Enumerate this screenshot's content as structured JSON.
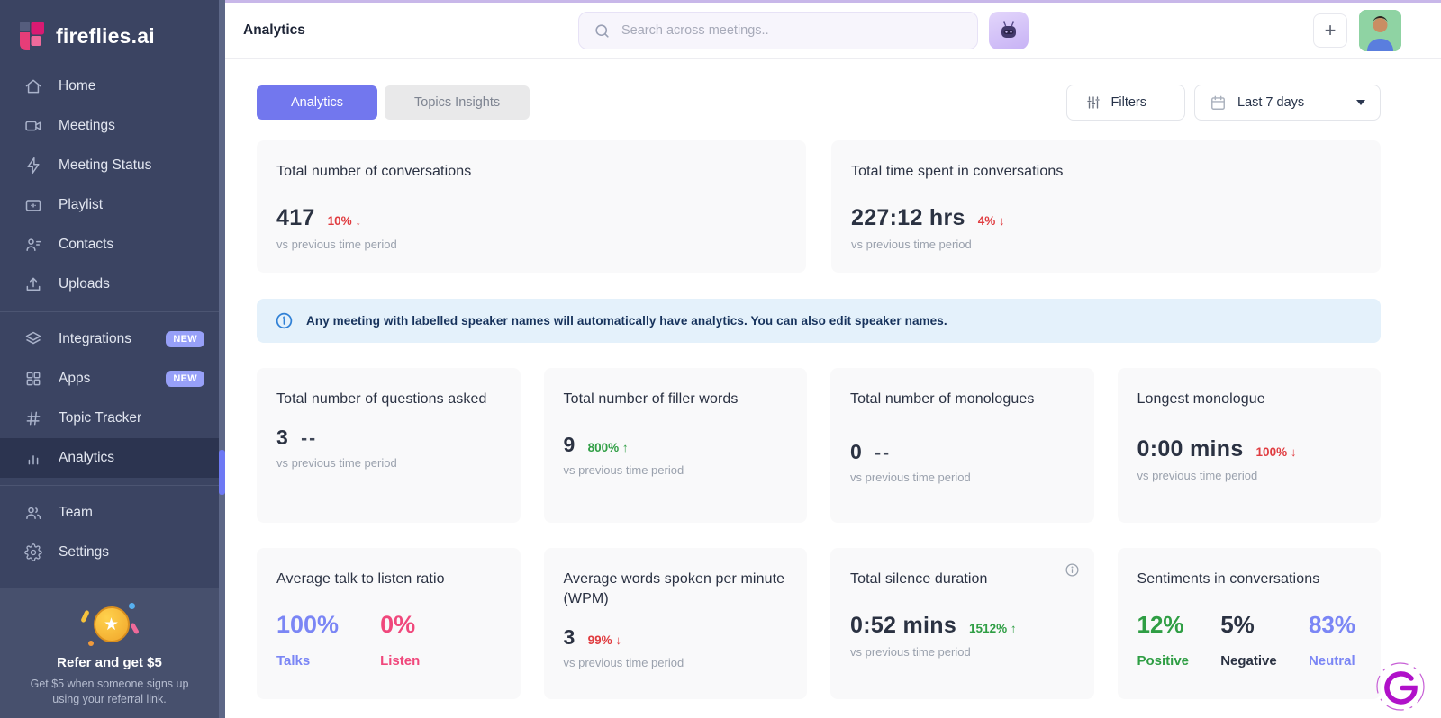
{
  "brand": {
    "name": "fireflies.ai"
  },
  "sidebar": {
    "items": [
      {
        "label": "Home"
      },
      {
        "label": "Meetings"
      },
      {
        "label": "Meeting Status"
      },
      {
        "label": "Playlist"
      },
      {
        "label": "Contacts"
      },
      {
        "label": "Uploads"
      },
      {
        "label": "Integrations",
        "badge": "NEW"
      },
      {
        "label": "Apps",
        "badge": "NEW"
      },
      {
        "label": "Topic Tracker"
      },
      {
        "label": "Analytics"
      },
      {
        "label": "Team"
      },
      {
        "label": "Settings"
      }
    ],
    "referral": {
      "title": "Refer and get $5",
      "subtitle": "Get $5 when someone signs up using your referral link."
    }
  },
  "header": {
    "title": "Analytics",
    "search_placeholder": "Search across meetings..",
    "plus_label": "+"
  },
  "toolbar": {
    "tabs": [
      {
        "label": "Analytics"
      },
      {
        "label": "Topics Insights"
      }
    ],
    "filters_label": "Filters",
    "date_range": "Last 7 days"
  },
  "banner": {
    "text": "Any meeting with labelled speaker names will automatically have analytics. You can also edit speaker names."
  },
  "cards": {
    "compare_label": "vs previous time period",
    "conversations": {
      "title": "Total number of conversations",
      "value": "417",
      "change": "10% ↓"
    },
    "time_spent": {
      "title": "Total time spent in conversations",
      "value": "227:12 hrs",
      "change": "4% ↓"
    },
    "questions": {
      "title": "Total number of questions asked",
      "value": "3",
      "change": "--"
    },
    "filler_words": {
      "title": "Total number of filler words",
      "value": "9",
      "change": "800% ↑"
    },
    "monologues": {
      "title": "Total number of monologues",
      "value": "0",
      "change": "--"
    },
    "longest_monologue": {
      "title": "Longest monologue",
      "value": "0:00 mins",
      "change": "100% ↓"
    },
    "talk_listen": {
      "title": "Average talk to listen ratio",
      "talks_value": "100%",
      "talks_label": "Talks",
      "listen_value": "0%",
      "listen_label": "Listen"
    },
    "wpm": {
      "title": "Average words spoken per minute (WPM)",
      "value": "3",
      "change": "99% ↓"
    },
    "silence": {
      "title": "Total silence duration",
      "value": "0:52 mins",
      "change": "1512% ↑"
    },
    "sentiments": {
      "title": "Sentiments in conversations",
      "positive": {
        "value": "12%",
        "label": "Positive"
      },
      "negative": {
        "value": "5%",
        "label": "Negative"
      },
      "neutral": {
        "value": "83%",
        "label": "Neutral"
      }
    }
  },
  "colors": {
    "sidebar_bg": "#3b4462",
    "active_tab": "#7277ee",
    "negative_change": "#e03c40",
    "positive_change": "#2f9e44",
    "talks": "#7b86f5",
    "listen": "#f0487c",
    "neutral": "#7b86f5",
    "banner_bg": "#e4f1fb"
  }
}
